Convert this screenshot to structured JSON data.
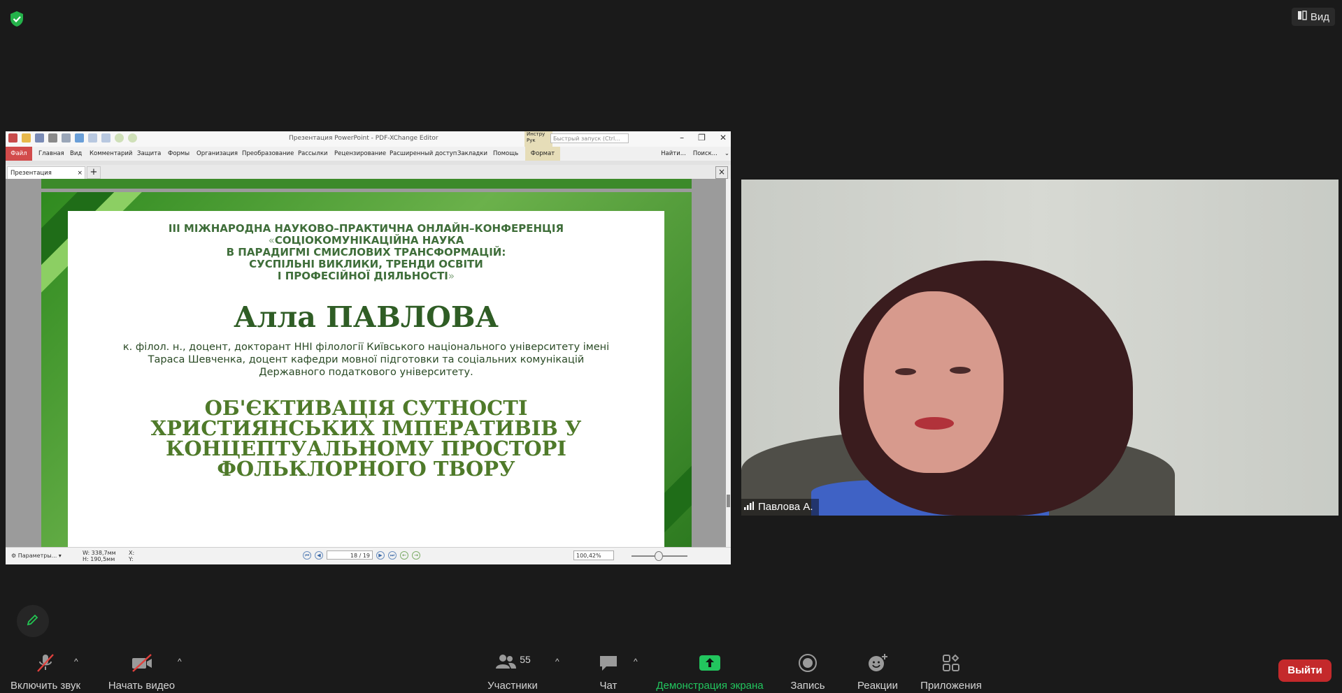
{
  "top": {
    "view_label": "Вид"
  },
  "shared_window": {
    "title": "Презентация PowerPoint - PDF-XChange Editor",
    "instr_tab": "Инстру Рук",
    "quick_search_placeholder": "Быстрый запуск (Ctrl...",
    "menu": {
      "file": "Файл",
      "items": [
        "Главная",
        "Вид",
        "Комментарий",
        "Защита",
        "Формы",
        "Организация",
        "Преобразование",
        "Рассылки",
        "Рецензирование",
        "Расширенный доступ",
        "Закладки",
        "Помощь"
      ],
      "format": "Формат",
      "find": "Найти...",
      "search": "Поиск..."
    },
    "doc_tab": "Презентация PowerPoint",
    "status": {
      "params": "Параметры...",
      "width": "W: 338,7мм",
      "height": "H: 190,5мм",
      "x": "X:",
      "y": "Y:",
      "page": "18 / 19",
      "zoom": "100,42%"
    }
  },
  "slide": {
    "conf_line1": "ІІІ МІЖНАРОДНА НАУКОВО–ПРАКТИЧНА ОНЛАЙН–КОНФЕРЕНЦІЯ",
    "conf_quote_open": "«",
    "conf_line2": "СОЦІОКОМУНІКАЦІЙНА НАУКА",
    "conf_line3": "В ПАРАДИГМІ СМИСЛОВИХ ТРАНСФОРМАЦІЙ:",
    "conf_line4": "СУСПІЛЬНІ ВИКЛИКИ, ТРЕНДИ ОСВІТИ",
    "conf_line5": "І ПРОФЕСІЙНОЇ ДІЯЛЬНОСТІ",
    "conf_quote_close": "»",
    "speaker_name": "Алла ПАВЛОВА",
    "speaker_info_1": "к. філол. н., доцент, докторант ННІ філології Київського національного університету імені",
    "speaker_info_2": "Тараса Шевченка, доцент кафедри мовної підготовки та соціальних комунікацій",
    "speaker_info_3": "Державного податкового університету.",
    "title_1": "ОБ'ЄКТИВАЦІЯ СУТНОСТІ",
    "title_2": "ХРИСТИЯНСЬКИХ ІМПЕРАТИВІВ У",
    "title_3": "КОНЦЕПТУАЛЬНОМУ ПРОСТОРІ",
    "title_4": "ФОЛЬКЛОРНОГО ТВОРУ"
  },
  "video": {
    "participant_name": "Павлова А."
  },
  "toolbar": {
    "unmute": "Включить звук",
    "start_video": "Начать видео",
    "participants": "Участники",
    "participants_count": "55",
    "chat": "Чат",
    "share_screen": "Демонстрация экрана",
    "record": "Запись",
    "reactions": "Реакции",
    "apps": "Приложения",
    "leave": "Выйти"
  },
  "colors": {
    "accent_green": "#22c55e",
    "leave_red": "#c4292b",
    "slide_green": "#3f6e3a"
  }
}
